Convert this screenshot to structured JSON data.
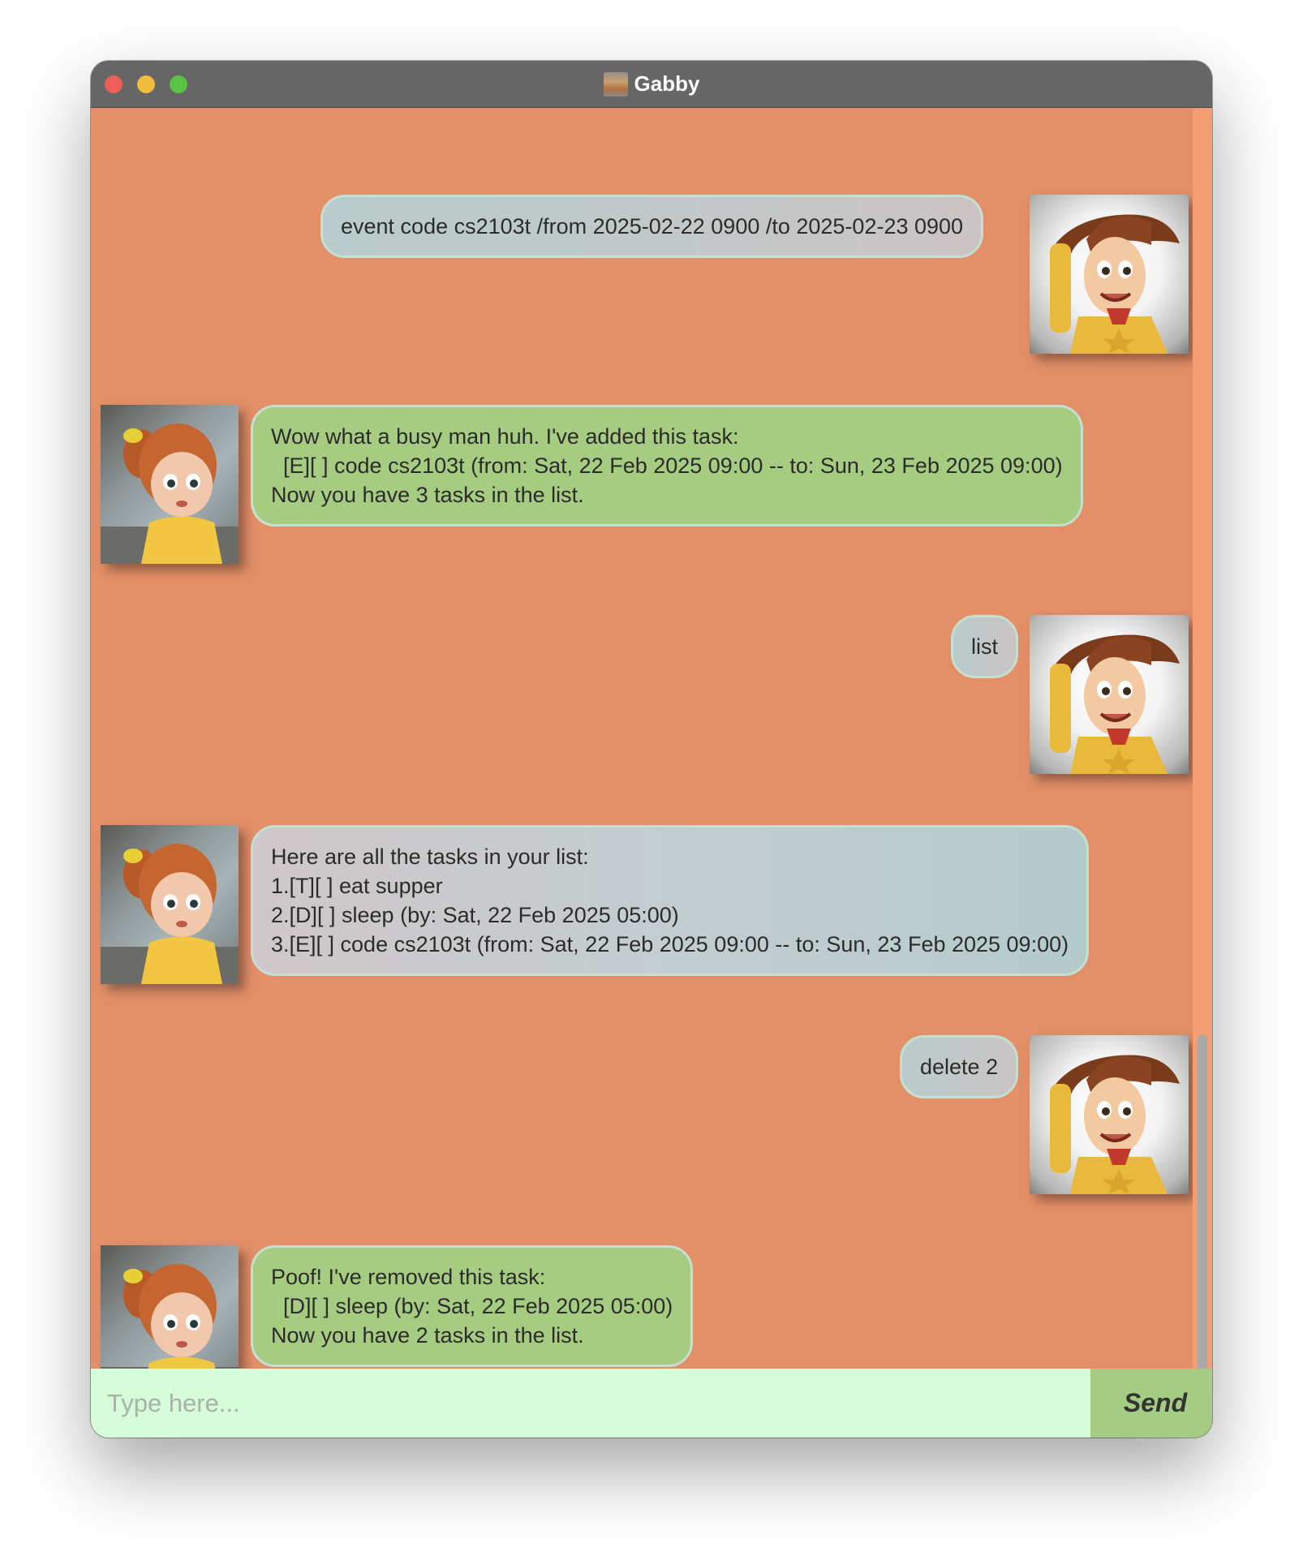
{
  "window": {
    "title": "Gabby",
    "title_icon": "gabby-app-icon"
  },
  "colors": {
    "titlebar": "#666666",
    "chat_background": "#e38f68",
    "bot_bubble": "#a6cc82",
    "user_bubble": "#c2c8c8",
    "input_background": "#d7fcd9",
    "send_button": "#a4cc82",
    "scroll_track": "#f49c72",
    "scroll_thumb": "#a9a9a9"
  },
  "messages": [
    {
      "sender": "user",
      "avatar": "woody-avatar",
      "text": "event code cs2103t /from 2025-02-22 0900 /to 2025-02-23 0900"
    },
    {
      "sender": "bot",
      "avatar": "gabby-avatar",
      "text": "Wow what a busy man huh. I've added this task:\n  [E][ ] code cs2103t (from: Sat, 22 Feb 2025 09:00 -- to: Sun, 23 Feb 2025 09:00)\nNow you have 3 tasks in the list."
    },
    {
      "sender": "user",
      "avatar": "woody-avatar",
      "text": "list"
    },
    {
      "sender": "bot",
      "avatar": "gabby-avatar",
      "text": "Here are all the tasks in your list:\n1.[T][ ] eat supper\n2.[D][ ] sleep (by: Sat, 22 Feb 2025 05:00)\n3.[E][ ] code cs2103t (from: Sat, 22 Feb 2025 09:00 -- to: Sun, 23 Feb 2025 09:00)"
    },
    {
      "sender": "user",
      "avatar": "woody-avatar",
      "text": "delete 2"
    },
    {
      "sender": "bot",
      "avatar": "gabby-avatar",
      "text": "Poof! I've removed this task:\n  [D][ ] sleep (by: Sat, 22 Feb 2025 05:00)\nNow you have 2 tasks in the list."
    }
  ],
  "input": {
    "placeholder": "Type here...",
    "value": ""
  },
  "send_button": {
    "label": "Send"
  }
}
